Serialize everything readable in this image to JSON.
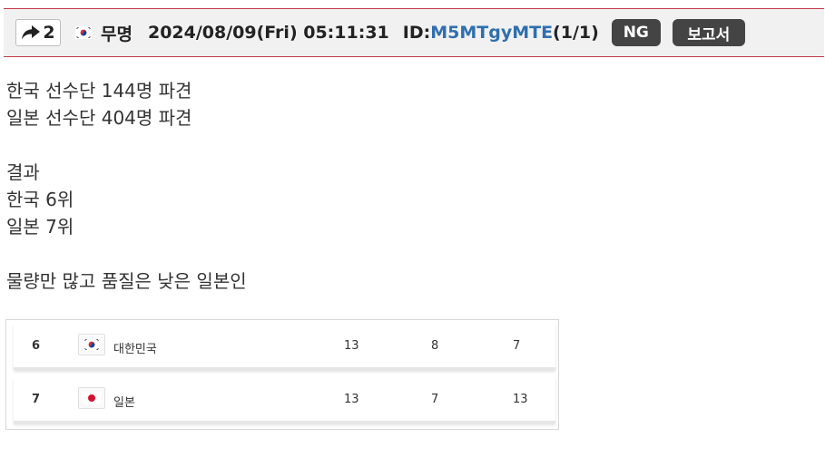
{
  "header": {
    "reply_count": "2",
    "author_name": "무명",
    "datetime": "2024/08/09(Fri) 05:11:31",
    "id_label": "ID:",
    "id_value": "M5MTgyMTE",
    "id_count": "(1/1)",
    "ng_label": "NG",
    "report_label": "보고서",
    "reply_icon": "reply-arrow-icon",
    "flag_icon": "korea-flag-icon",
    "accent_color": "#c4394a",
    "id_color": "#2f6fb0"
  },
  "body": {
    "lines": [
      "한국 선수단 144명 파견",
      "일본 선수단 404명 파견",
      "",
      "결과",
      "한국 6위",
      "일본 7위",
      "",
      "물량만 많고 품질은 낮은 일본인"
    ]
  },
  "medal_table": {
    "rows": [
      {
        "rank": "6",
        "country": "대한민국",
        "flag_icon": "korea-flag-icon",
        "gold": "13",
        "silver": "8",
        "bronze": "7"
      },
      {
        "rank": "7",
        "country": "일본",
        "flag_icon": "japan-flag-icon",
        "gold": "13",
        "silver": "7",
        "bronze": "13"
      }
    ]
  }
}
